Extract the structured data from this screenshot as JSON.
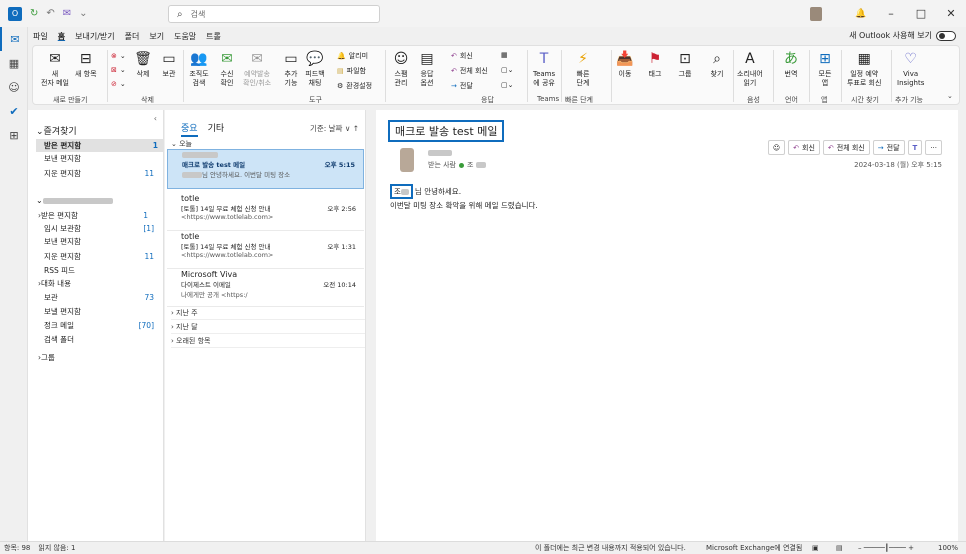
{
  "titlebar": {
    "search_placeholder": "검색",
    "app_initial": "O",
    "quick": [
      "↻",
      "↶",
      "✉",
      "⌄"
    ]
  },
  "window_controls": {
    "bell": "🔔",
    "min": "–",
    "max": "□",
    "close": "✕"
  },
  "menu": {
    "items": [
      "파일",
      "홈",
      "보내기/받기",
      "폴더",
      "보기",
      "도움말",
      "트롤"
    ],
    "selected": "홈"
  },
  "new_outlook": {
    "label": "새 Outlook 사용해 보기",
    "toggle_text": "끔"
  },
  "ribbon": {
    "new_mail": "새\n전자 메일",
    "new_item": "새 항목",
    "group_new": "새로 만들기",
    "delete": "삭제",
    "archive": "보관",
    "group_delete": "삭제",
    "org_search": "조직도\n검색",
    "accept": "수신\n확인",
    "schedule": "예약발송\n확인/취소",
    "add": "추가\n기능",
    "feedback": "피드백\n채팅",
    "notify": "알리미",
    "file": "파일함",
    "settings": "환경설정",
    "group_tools": "도구",
    "spam": "스팸\n관리",
    "response": "응답\n옵션",
    "reply": "회신",
    "reply_all": "전체 회신",
    "forward": "전달",
    "group_reply": "응답",
    "teams_share": "Teams\n에 공유",
    "group_teams": "Teams",
    "quick_steps": "빠른\n단계",
    "group_quick": "빠른 단계",
    "move": "이동",
    "tag": "태그",
    "group": "그룹",
    "find": "찾기",
    "read_aloud": "소리내어\n읽기",
    "group_voice": "음성",
    "translate": "번역",
    "group_lang": "언어",
    "all_apps": "모든\n앱",
    "group_apps": "앱",
    "schedule_poll": "일정 예약\n투표로 회신",
    "group_time": "시간 찾기",
    "viva": "Viva\nInsights",
    "group_addins": "추가 기능"
  },
  "folders": {
    "favorites_label": "즐겨찾기",
    "favorites": [
      {
        "name": "받은 편지함",
        "count": "1"
      },
      {
        "name": "보낸 편지함",
        "count": ""
      },
      {
        "name": "지운 편지함",
        "count": "11"
      }
    ],
    "mailbox": [
      {
        "name": "받은 편지함",
        "count": "1",
        "prefix": "›"
      },
      {
        "name": "임시 보관함",
        "count": "[1]",
        "prefix": ""
      },
      {
        "name": "보낸 편지함",
        "count": "",
        "prefix": ""
      },
      {
        "name": "지운 편지함",
        "count": "11",
        "prefix": ""
      },
      {
        "name": "RSS 피드",
        "count": "",
        "prefix": ""
      },
      {
        "name": "대화 내용",
        "count": "",
        "prefix": "›"
      },
      {
        "name": "보관",
        "count": "73",
        "prefix": ""
      },
      {
        "name": "보낼 편지함",
        "count": "",
        "prefix": ""
      },
      {
        "name": "정크 메일",
        "count": "[70]",
        "prefix": ""
      },
      {
        "name": "검색 폴더",
        "count": "",
        "prefix": ""
      }
    ],
    "groups_label": "그룹"
  },
  "list": {
    "tab_focused": "중요",
    "tab_other": "기타",
    "sort": "기준: 날짜 ∨  ↑",
    "section_today": "오늘",
    "messages": [
      {
        "from": "",
        "subject": "매크로 발송 test 메일",
        "preview": "님 안녕하세요. 이번달 미팅 장소",
        "time": "오후 5:15",
        "selected": true
      },
      {
        "from": "totle",
        "subject": "[토톨] 14일 무료 체험 신청 안내",
        "preview": "<https://www.totlelab.com>",
        "time": "오후 2:56",
        "selected": false
      },
      {
        "from": "totle",
        "subject": "[토톨] 14일 무료 체험 신청 안내",
        "preview": "<https://www.totlelab.com>",
        "time": "오후 1:31",
        "selected": false
      },
      {
        "from": "Microsoft Viva",
        "subject": "다이제스트 이메일",
        "preview": "나에게만 공개 <https:/",
        "time": "오전 10:14",
        "selected": false
      }
    ],
    "groups": [
      "지난 주",
      "지난 달",
      "오래된 항목"
    ]
  },
  "reading": {
    "subject": "매크로 발송 test 메일",
    "received_label": "받는 사람",
    "recipient_initial": "조",
    "reply": "회신",
    "reply_all": "전체 회신",
    "forward": "전달",
    "more": "···",
    "emoji": "☺",
    "date": "2024-03-18 (월) 오후 5:15",
    "greet_name": "조",
    "greeting": "님 안녕하세요.",
    "body": "이번달 미팅 장소 확악을 위해 메일 드렸습니다."
  },
  "status": {
    "items": "항목: 98",
    "unread": "읽지 않음: 1",
    "notice": "이 폴더에는 최근 변경 내용까지 적용되어 있습니다.",
    "connection": "Microsoft Exchange에 연결됨",
    "zoom": "100%"
  }
}
